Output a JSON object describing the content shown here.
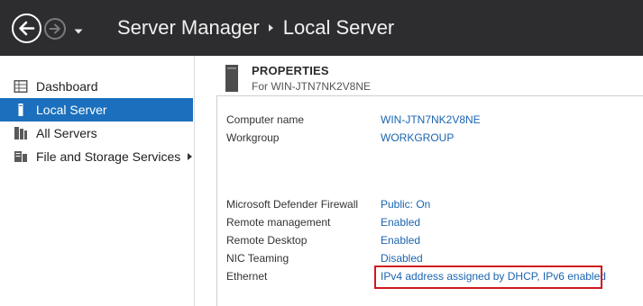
{
  "titlebar": {
    "app_title": "Server Manager",
    "page_title": "Local Server"
  },
  "sidebar": {
    "items": [
      {
        "label": "Dashboard",
        "icon": "dashboard-icon"
      },
      {
        "label": "Local Server",
        "icon": "server-icon",
        "active": true
      },
      {
        "label": "All Servers",
        "icon": "servers-icon"
      },
      {
        "label": "File and Storage Services",
        "icon": "storage-icon",
        "has_submenu": true
      }
    ]
  },
  "properties": {
    "title": "PROPERTIES",
    "subtitle": "For WIN-JTN7NK2V8NE",
    "rows": [
      {
        "key": "Computer name",
        "value": "WIN-JTN7NK2V8NE"
      },
      {
        "key": "Workgroup",
        "value": "WORKGROUP"
      },
      {
        "key": "Microsoft Defender Firewall",
        "value": "Public: On"
      },
      {
        "key": "Remote management",
        "value": "Enabled"
      },
      {
        "key": "Remote Desktop",
        "value": "Enabled"
      },
      {
        "key": "NIC Teaming",
        "value": "Disabled"
      },
      {
        "key": "Ethernet",
        "value": "IPv4 address assigned by DHCP, IPv6 enabled"
      }
    ]
  },
  "colors": {
    "titlebar_bg": "#2d2d30",
    "active_item_bg": "#1b6fbd",
    "link": "#1b64b0",
    "highlight": "#d0191d"
  }
}
